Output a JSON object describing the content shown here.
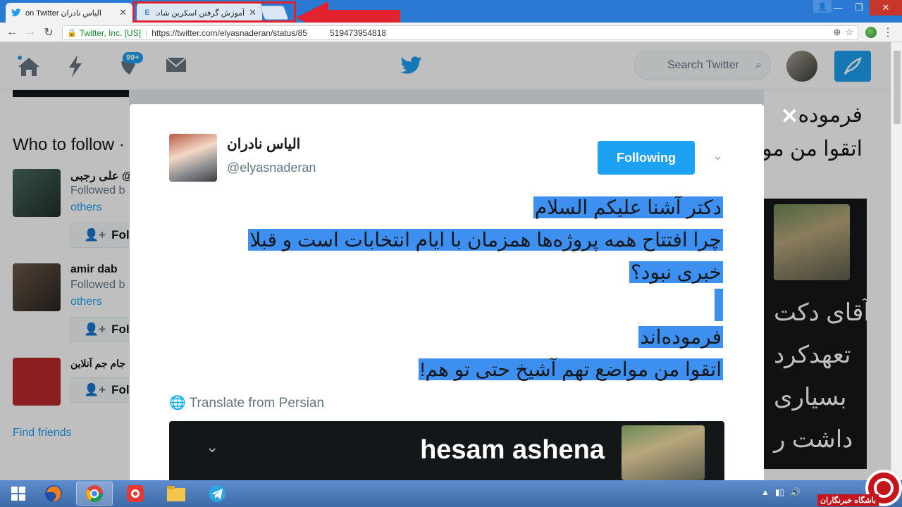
{
  "browser": {
    "tabs": [
      {
        "title": "الیاس نادران on Twitter",
        "active": true
      },
      {
        "title": "آموزش گرفتن اسکرین شات",
        "active": false
      }
    ],
    "address": {
      "security_label": "Twitter, Inc. [US]",
      "url_prefix": "https://twitter.com/elyasnaderan/status/85",
      "url_rest": "519473954818"
    }
  },
  "twitter": {
    "header": {
      "notification_badge": "99+",
      "search_placeholder": "Search Twitter"
    },
    "who_to_follow": {
      "title": "Who to follow ·",
      "items": [
        {
          "name": "علی رجبی @",
          "followed_by": "Followed b",
          "others": "others",
          "button": "Foll"
        },
        {
          "name": "amir dab",
          "followed_by": "Followed b",
          "others": "others",
          "button": "Foll"
        },
        {
          "name": "جام جم آنلاین",
          "followed_by": "",
          "others": "",
          "button": "Foll"
        }
      ],
      "find_friends": "Find friends"
    },
    "right_column": {
      "line1": "فرمودە",
      "line2": "اتقوا من مو",
      "card_lines": [
        "آقای دکت",
        "تعهدکرد",
        "بسیاری",
        "داشت ر"
      ]
    }
  },
  "modal": {
    "close": "✕",
    "user_name": "الیاس نادران",
    "user_handle": "@elyasnaderan",
    "follow_button": "Following",
    "tweet_lines": [
      "دکتر آشنا علیکم السلام",
      "چرا افتتاح همه پروژه‌ها همزمان با ایام انتخابات است و قبلا",
      "خبری نبود؟",
      "",
      "فرموده‌اند",
      "اتقوا من مواضع تهم آشیخ حتی تو هم!"
    ],
    "translate_label": "Translate from Persian",
    "quoted_name": "hesam ashena"
  },
  "watermark": {
    "text": "باشگاه خبرنگاران"
  },
  "colors": {
    "twitter_blue": "#1da1f2",
    "selection": "#3d8ff0",
    "annotation_red": "#e0232e"
  }
}
